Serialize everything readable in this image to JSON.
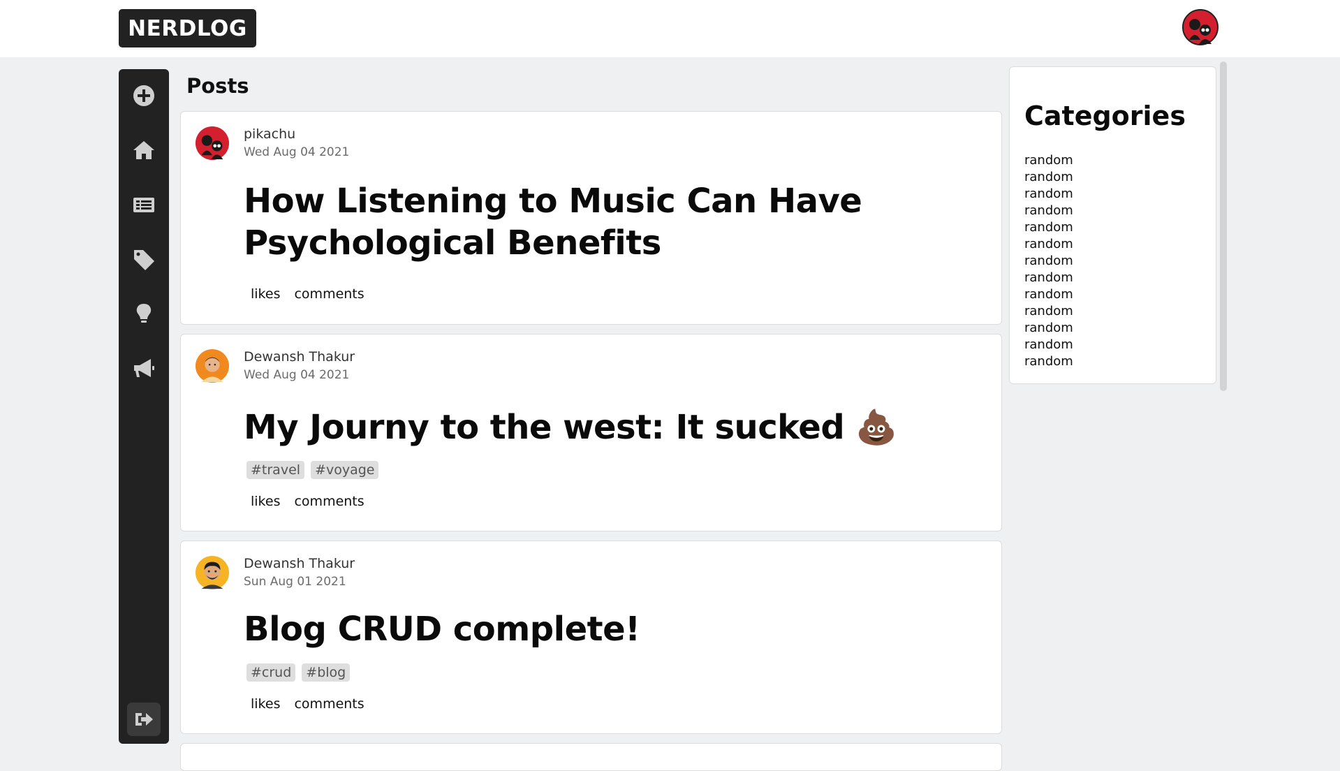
{
  "app": {
    "logo_text": "NERDLOG"
  },
  "sidebar": {
    "items": [
      {
        "icon": "plus-circle-icon",
        "label": "Create post"
      },
      {
        "icon": "home-icon",
        "label": "Home"
      },
      {
        "icon": "list-icon",
        "label": "Posts"
      },
      {
        "icon": "tag-icon",
        "label": "Tags"
      },
      {
        "icon": "lightbulb-icon",
        "label": "Ideas"
      },
      {
        "icon": "megaphone-icon",
        "label": "Announcements"
      }
    ],
    "logout_icon": "logout-icon"
  },
  "main": {
    "heading": "Posts",
    "posts": [
      {
        "author": "pikachu",
        "date": "Wed Aug 04 2021",
        "title_lines": [
          "How Listening to Music Can Have",
          "Psychological Benefits"
        ],
        "tags": [],
        "likes_label": "likes",
        "comments_label": "comments"
      },
      {
        "author": "Dewansh Thakur",
        "date": "Wed Aug 04 2021",
        "title_lines": [
          "My Journy to the west: It sucked 💩"
        ],
        "tags": [
          "#travel",
          "#voyage"
        ],
        "likes_label": "likes",
        "comments_label": "comments"
      },
      {
        "author": "Dewansh Thakur",
        "date": "Sun Aug 01 2021",
        "title_lines": [
          "Blog CRUD complete!"
        ],
        "tags": [
          "#crud",
          "#blog"
        ],
        "likes_label": "likes",
        "comments_label": "comments"
      }
    ]
  },
  "categories": {
    "heading": "Categories",
    "items": [
      "random",
      "random",
      "random",
      "random",
      "random",
      "random",
      "random",
      "random",
      "random",
      "random",
      "random",
      "random",
      "random"
    ]
  },
  "colors": {
    "dark": "#222222",
    "page_bg": "#eff0f1",
    "card_bg": "#ffffff",
    "tag_bg": "#dedede",
    "avatar_red": "#d4202e"
  }
}
